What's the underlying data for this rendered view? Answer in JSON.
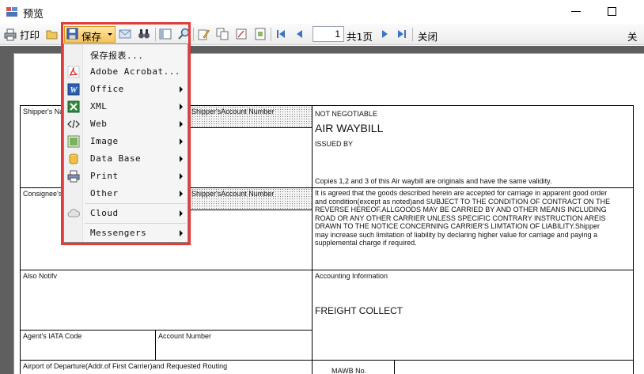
{
  "window": {
    "title": "预览"
  },
  "toolbar": {
    "print_label": "打印",
    "save_label": "保存",
    "page_value": "1",
    "total_pages": "共1页",
    "close_label": "关闭",
    "close_right": "关于"
  },
  "menu": {
    "items": [
      {
        "label": "保存报表...",
        "icon": "none"
      },
      {
        "label": "Adobe Acrobat...",
        "icon": "pdf-icon"
      },
      {
        "label": "Office",
        "icon": "word-icon"
      },
      {
        "label": "XML",
        "icon": "excel-xml-icon"
      },
      {
        "label": "Web",
        "icon": "code-tag-icon"
      },
      {
        "label": "Image",
        "icon": "image-icon"
      },
      {
        "label": "Data Base",
        "icon": "database-icon"
      },
      {
        "label": "Print",
        "icon": "printer-icon"
      },
      {
        "label": "Other",
        "icon": "none"
      },
      {
        "label": "Cloud",
        "icon": "cloud-icon"
      },
      {
        "label": "Messengers",
        "icon": "none"
      }
    ]
  },
  "waybill": {
    "shipper_name": "Shipper's Na",
    "shipper_account": "Shipper'sAccount Number",
    "not_negotiable": "NOT NEGOTIABLE",
    "air_waybill": "AIR WAYBILL",
    "issued_by": "ISSUED BY",
    "copies_note": "Copies 1,2 and 3 of this Air waybill are originals and have the same validity.",
    "consignee": "Consignee's",
    "consignee_account": "Shipper'sAccount Number",
    "conditions": [
      "It is agreed that the goods described herein are accepted for carriage in apparent good order",
      "and condition(except as noted)and SUBJECT TO THE CONDITION OF CONTRACT ON THE",
      "REVERSE HEREOF.ALLGOODS MAY BE CARRIED BY AND OTHER MEANS INCLUDING",
      "ROAD OR ANY OTHER CARRIER UNLESS SPECIFIC CONTRARY INSTRUCTION AREIS",
      "DRAWN TO THE NOTICE CONCERNING CARRIER'S LIMTATION OF LIABILITY.Shipper",
      "may increase such limitation of liability by declaring higher value for carriage and paying a",
      "supplemental charge if required."
    ],
    "also_notify": "Also Notifv",
    "accounting_info": "Accounting Information",
    "freight_collect": "FREIGHT COLLECT",
    "agent_iata": "Agent's IATA Code",
    "account_number": "Account Number",
    "airport_departure": "Airport of Departure(Addr.of First Carrier)and Requested Routing",
    "mawb_no": "MAWB No."
  },
  "colors": {
    "highlight": "#e33a3a",
    "save_button": "#f7c35c",
    "doc_background": "#5f5f5f"
  }
}
